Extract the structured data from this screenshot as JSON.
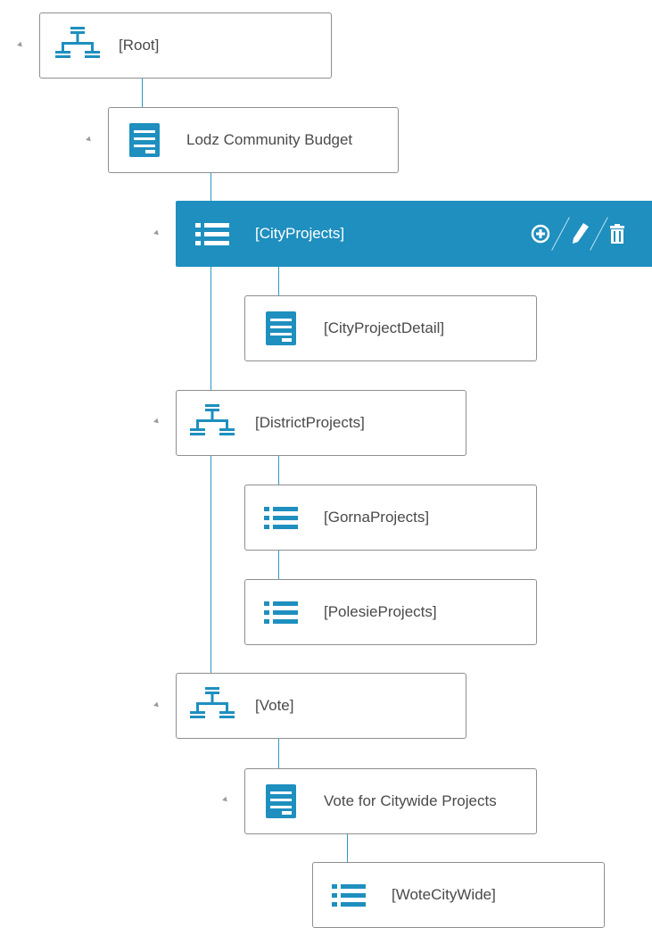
{
  "colors": {
    "accent": "#1e8fbf",
    "icon": "#1e8fbf",
    "connector": "#2a98c6",
    "border": "#8e8e8e"
  },
  "tree": {
    "root": {
      "label": "[Root]",
      "icon": "sitemap-icon"
    },
    "budget": {
      "label": "Lodz Community Budget",
      "icon": "form-icon"
    },
    "city_projects": {
      "label": "[CityProjects]",
      "icon": "list-icon",
      "selected": true,
      "actions": [
        "add-icon",
        "edit-icon",
        "delete-icon"
      ]
    },
    "city_project_detail": {
      "label": "[CityProjectDetail]",
      "icon": "form-icon"
    },
    "district_projects": {
      "label": "[DistrictProjects]",
      "icon": "sitemap-icon"
    },
    "gorna_projects": {
      "label": "[GornaProjects]",
      "icon": "list-icon"
    },
    "polesie_projects": {
      "label": "[PolesieProjects]",
      "icon": "list-icon"
    },
    "vote": {
      "label": "[Vote]",
      "icon": "sitemap-icon"
    },
    "vote_citywide": {
      "label": "Vote for Citywide Projects",
      "icon": "form-icon"
    },
    "wote_citywide": {
      "label": "[WoteCityWide]",
      "icon": "list-icon"
    }
  }
}
